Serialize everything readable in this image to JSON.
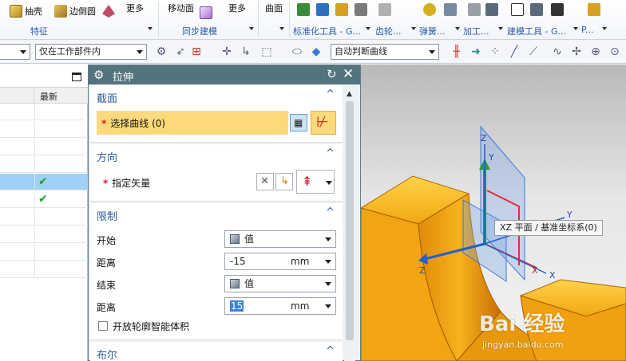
{
  "ribbon": {
    "items": [
      {
        "label": "抽壳"
      },
      {
        "label": "边倒圆"
      },
      {
        "label": "更多"
      },
      {
        "label": "移动面"
      },
      {
        "label": "更多"
      },
      {
        "label": "曲面"
      }
    ],
    "groups": [
      {
        "label": "特征"
      },
      {
        "label": "同步建模"
      },
      {
        "label": "标准化工具 - G..."
      },
      {
        "label": "齿轮..."
      },
      {
        "label": "弹簧..."
      },
      {
        "label": "加工..."
      },
      {
        "label": "建模工具 - G..."
      },
      {
        "label": "P..."
      }
    ]
  },
  "toolbar2": {
    "selection_scope": "仅在工作部件内",
    "curve_rule": "自动判断曲线"
  },
  "navigator": {
    "column_latest": "最新",
    "rows": [
      {
        "latest": ""
      },
      {
        "latest": ""
      },
      {
        "latest": ""
      },
      {
        "latest": ""
      },
      {
        "latest": "✔"
      },
      {
        "latest": "✔"
      },
      {
        "latest": ""
      },
      {
        "latest": ""
      },
      {
        "latest": ""
      },
      {
        "latest": ""
      }
    ]
  },
  "dialog": {
    "title": "拉伸",
    "section": {
      "header": "截面",
      "select_curve_label": "选择曲线 (0)"
    },
    "direction": {
      "header": "方向",
      "specify_vector_label": "指定矢量"
    },
    "limits": {
      "header": "限制",
      "start_label": "开始",
      "start_value": "值",
      "distance1_label": "距离",
      "distance1_value": "-15",
      "distance1_unit": "mm",
      "end_label": "结束",
      "end_value": "值",
      "distance2_label": "距离",
      "distance2_value": "15",
      "distance2_unit": "mm",
      "open_profile_label": "开放轮廓智能体积"
    },
    "boolean": {
      "header": "布尔"
    }
  },
  "viewport": {
    "tooltip": "XZ 平面 / 基准坐标系(0)",
    "axis_z_top": "Z",
    "axis_y_top": "Y",
    "axis_z_bottom": "Z",
    "axis_x_bottom": "X",
    "axis_x_red": "X",
    "axis_y_right": "Y"
  },
  "watermark": {
    "main": "Bai 经验",
    "sub": "jingyan.baidu.com"
  }
}
